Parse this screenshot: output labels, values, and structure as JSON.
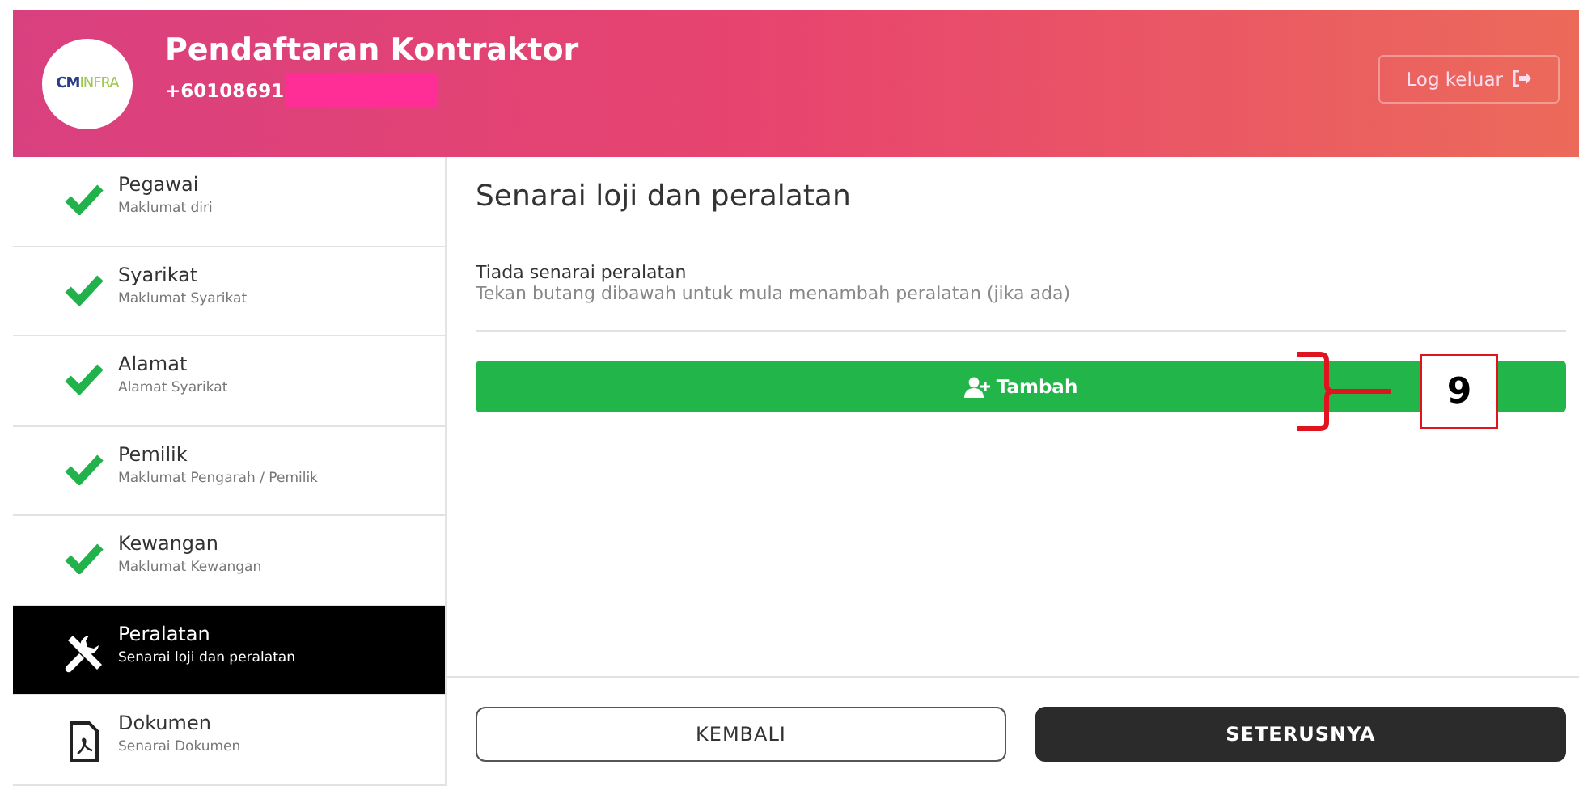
{
  "header": {
    "logo": "CMINFRA",
    "title": "Pendaftaran Kontraktor",
    "phone": "+60108691",
    "phone_redacted": true,
    "logout": "Log keluar"
  },
  "sidebar": {
    "items": [
      {
        "title": "Pegawai",
        "subtitle": "Maklumat diri",
        "kind": "done",
        "selected": false
      },
      {
        "title": "Syarikat",
        "subtitle": "Maklumat Syarikat",
        "kind": "done",
        "selected": false
      },
      {
        "title": "Alamat",
        "subtitle": "Alamat Syarikat",
        "kind": "done",
        "selected": false
      },
      {
        "title": "Pemilik",
        "subtitle": "Maklumat Pengarah / Pemilik",
        "kind": "done",
        "selected": false
      },
      {
        "title": "Kewangan",
        "subtitle": "Maklumat Kewangan",
        "kind": "done",
        "selected": false
      },
      {
        "title": "Peralatan",
        "subtitle": "Senarai loji dan peralatan",
        "kind": "tools",
        "selected": true
      },
      {
        "title": "Dokumen",
        "subtitle": "Senarai Dokumen",
        "kind": "document",
        "selected": false
      }
    ]
  },
  "main": {
    "heading": "Senarai loji dan peralatan",
    "empty_title": "Tiada senarai peralatan",
    "empty_hint": "Tekan butang dibawah untuk mula menambah peralatan (jika ada)",
    "add_button": "Tambah",
    "annotation": "9"
  },
  "footer": {
    "back_button": "KEMBALI",
    "next_button": "SETERUSNYA"
  }
}
